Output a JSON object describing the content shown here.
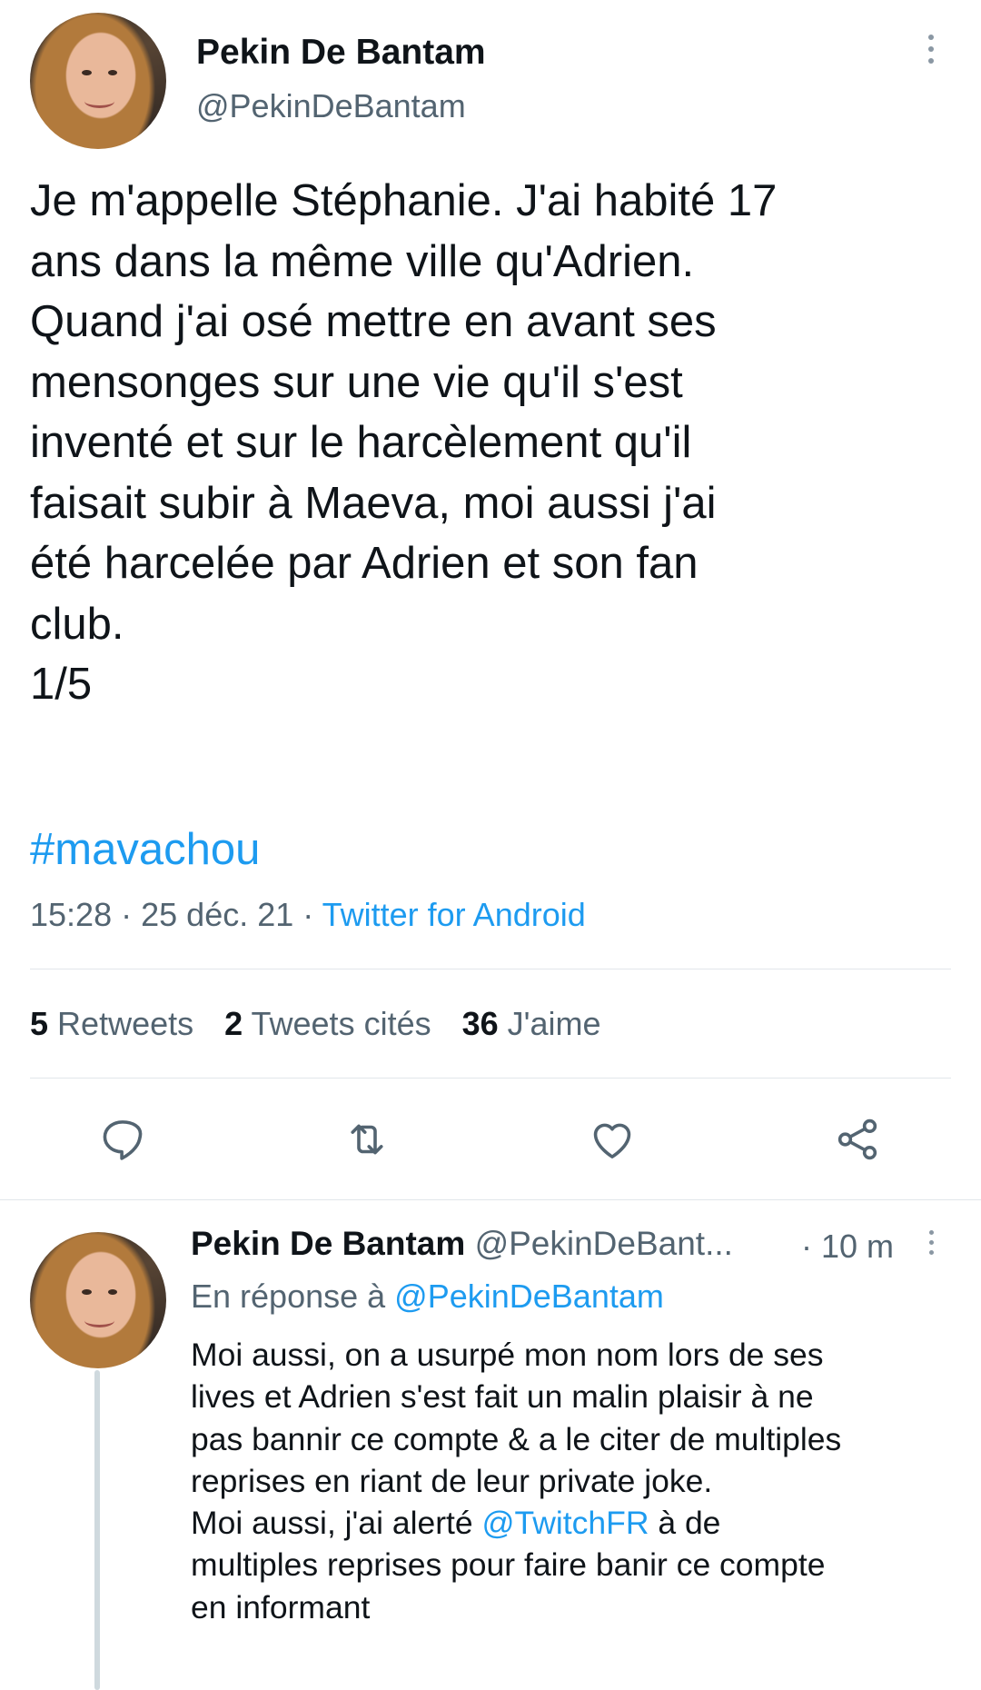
{
  "main_tweet": {
    "display_name": "Pekin De Bantam",
    "handle": "@PekinDeBantam",
    "text": "Je m'appelle Stéphanie. J'ai habité 17\nans dans la même ville qu'Adrien.\nQuand j'ai osé mettre en avant ses\nmensonges sur une vie qu'il s'est\ninventé et sur le harcèlement qu'il\nfaisait subir à Maeva, moi aussi j'ai\nété harcelée par Adrien et son fan\nclub.\n1/5",
    "hashtag": "#mavachou",
    "time": "15:28",
    "separator": "·",
    "date": "25 déc. 21",
    "source": "Twitter for Android"
  },
  "stats": [
    {
      "count": "5",
      "label": "Retweets"
    },
    {
      "count": "2",
      "label": "Tweets cités"
    },
    {
      "count": "36",
      "label": "J'aime"
    }
  ],
  "actions": [
    {
      "icon": "reply-icon"
    },
    {
      "icon": "retweet-icon"
    },
    {
      "icon": "like-icon"
    },
    {
      "icon": "share-icon"
    }
  ],
  "reply_tweet": {
    "display_name": "Pekin De Bantam",
    "handle": "@PekinDeBant...",
    "time": "· 10 m",
    "in_reply_prefix": "En réponse à",
    "in_reply_handle": "@PekinDeBantam",
    "text_part1": "Moi aussi, on a usurpé mon nom lors de ses\nlives et Adrien s'est fait un malin plaisir à ne\npas bannir ce compte & a le citer de multiples\nreprises en riant de leur private joke.\nMoi aussi, j'ai alerté ",
    "mention": "@TwitchFR",
    "text_part2": " à de\nmultiples reprises pour faire banir ce compte\nen informant"
  },
  "colors": {
    "accent": "#1d9bf0",
    "text": "#0f1419",
    "muted": "#536471",
    "divider": "#e1e6ea"
  }
}
